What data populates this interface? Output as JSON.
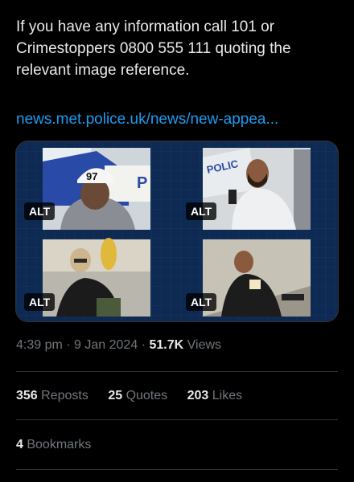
{
  "tweet": {
    "text": "If you have any information call 101 or Crimestoppers 0800 555 111 quoting the relevant image reference.",
    "link": "news.met.police.uk/news/new-appea..."
  },
  "media": {
    "images": [
      {
        "alt": "ALT",
        "subject": "man in white cap with number 97 and grey hoodie beside police car",
        "cap_text": "97"
      },
      {
        "alt": "ALT",
        "subject": "bearded man in white jacket beside police van",
        "van_text": "POLIC"
      },
      {
        "alt": "ALT",
        "subject": "person in beige hood and dark jacket on street"
      },
      {
        "alt": "ALT",
        "subject": "man in black clothing walking on pavement"
      }
    ],
    "colors": {
      "frame": "#0e2a52",
      "accent": "#1d4d8f"
    }
  },
  "meta": {
    "time": "4:39 pm",
    "separator1": "·",
    "date": "9 Jan 2024",
    "separator2": "·",
    "views_count": "51.7K",
    "views_label": "Views"
  },
  "stats": {
    "reposts_count": "356",
    "reposts_label": "Reposts",
    "quotes_count": "25",
    "quotes_label": "Quotes",
    "likes_count": "203",
    "likes_label": "Likes"
  },
  "bookmarks": {
    "count": "4",
    "label": "Bookmarks"
  },
  "colors": {
    "link": "#1d9bf0",
    "text": "#e7e9ea",
    "muted": "#71767b",
    "divider": "#2f3336"
  }
}
